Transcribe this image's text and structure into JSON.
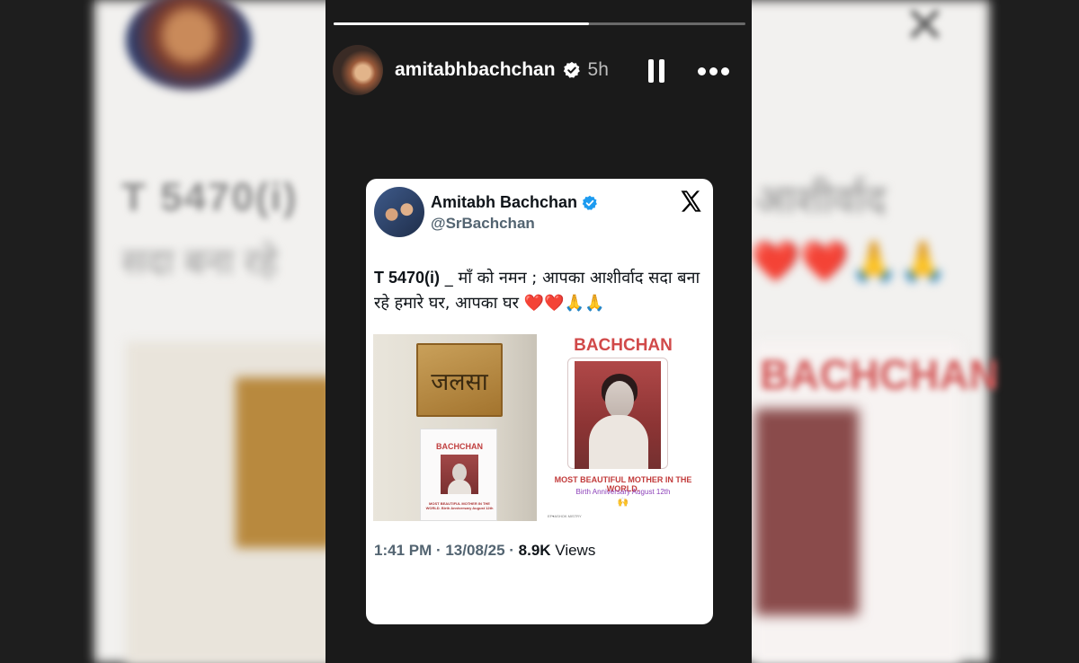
{
  "story": {
    "username": "amitabhbachchan",
    "time": "5h",
    "progress": 0.62
  },
  "tweet": {
    "name": "Amitabh Bachchan",
    "handle": "@SrBachchan",
    "text_id": "T 5470(i)",
    "text_body": " _ माँ को नमन  ; आपका आशीर्वाद सदा बना रहे हमारे घर, आपका घर ",
    "emojis": "❤️❤️🙏🙏",
    "time": "1:41 PM · 13/08/25 · ",
    "views_count": "8.9K",
    "views_label": " Views"
  },
  "media": {
    "nameplate": "जलसा",
    "poster_small_title": "BACHCHAN",
    "poster_small_caption": "MOST BEAUTIFUL MOTHER IN THE WORLD. Birth Anniversary August 12th",
    "poster_title": "BACHCHAN",
    "poster_tagline": "MOST BEAUTIFUL MOTHER IN THE WORLD.",
    "poster_anniversary": "Birth Anniversary August 12th",
    "poster_hands": "🙌",
    "poster_credit": "EF♥ASHOK MISTRY"
  },
  "colors": {
    "verified_blue": "#1d9bf0",
    "poster_red": "#d14a4a",
    "anniversary_purple": "#8b3fb8"
  },
  "icons": [
    "verified-icon",
    "pause-icon",
    "more-icon",
    "x-logo-icon"
  ]
}
